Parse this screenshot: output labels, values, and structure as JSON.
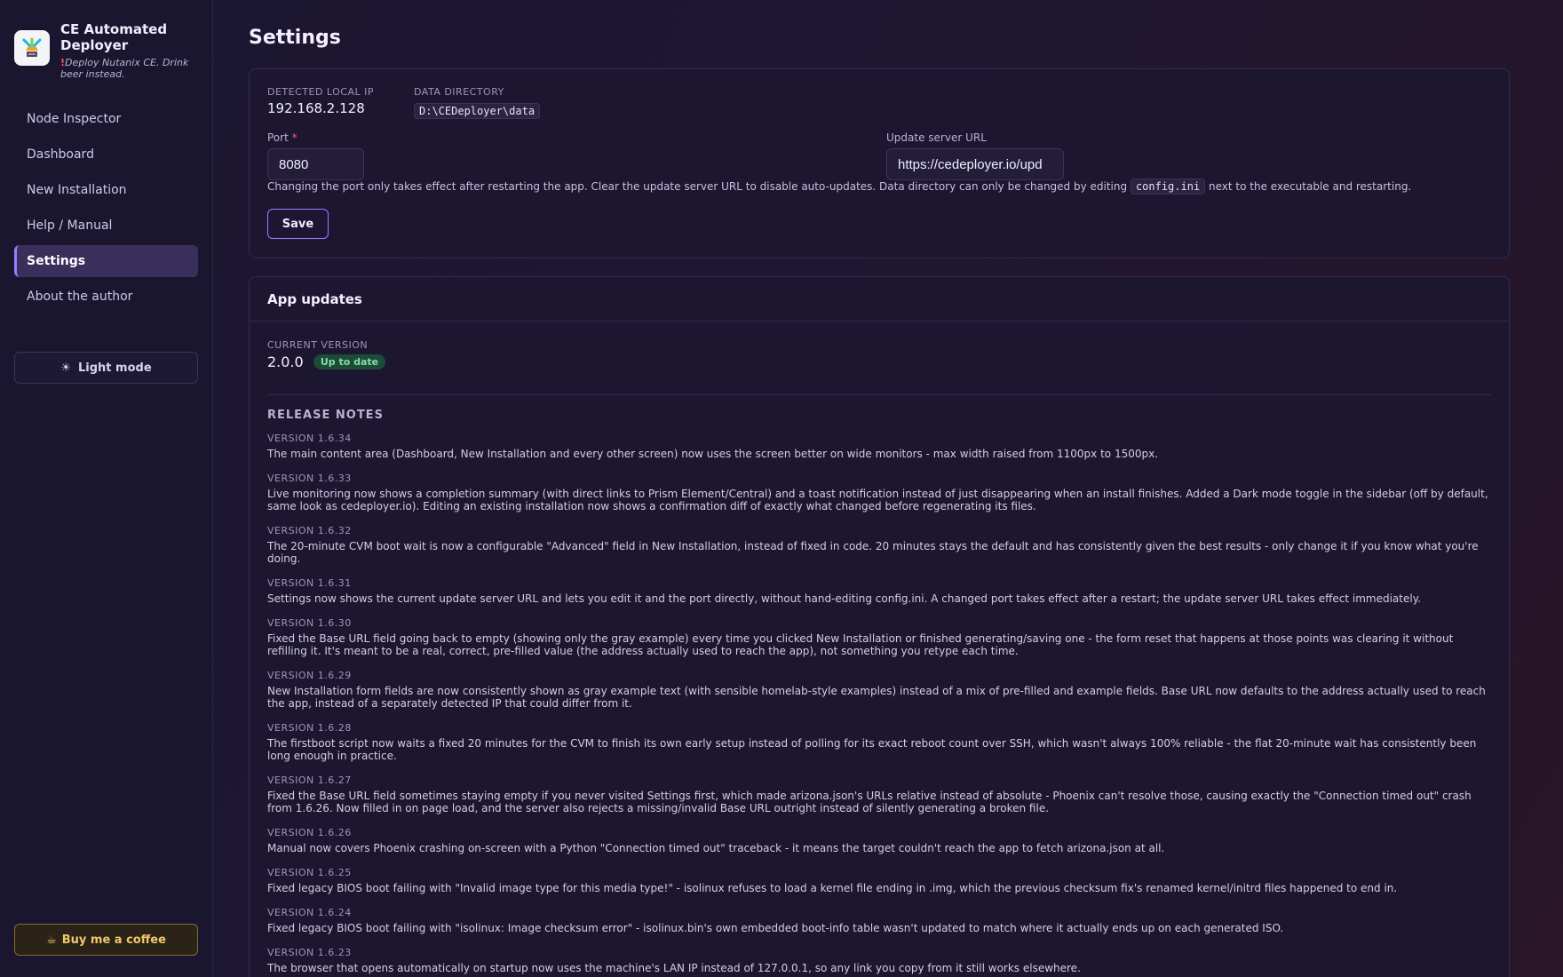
{
  "brand": {
    "title": "CE Automated Deployer",
    "tagline_mark": "!",
    "tagline": "Deploy Nutanix CE. Drink beer instead."
  },
  "sidebar": {
    "items": [
      {
        "label": "Node Inspector",
        "active": false
      },
      {
        "label": "Dashboard",
        "active": false
      },
      {
        "label": "New Installation",
        "active": false
      },
      {
        "label": "Help / Manual",
        "active": false
      },
      {
        "label": "Settings",
        "active": true
      },
      {
        "label": "About the author",
        "active": false
      }
    ],
    "theme_toggle": {
      "icon": "sun-icon",
      "label": "Light mode"
    },
    "coffee": {
      "icon": "coffee-icon",
      "label": "Buy me a coffee"
    }
  },
  "page": {
    "title": "Settings"
  },
  "settings": {
    "local_ip_label": "Detected local IP",
    "local_ip": "192.168.2.128",
    "data_dir_label": "Data directory",
    "data_dir": "D:\\CEDeployer\\data",
    "port_label": "Port",
    "port_required": "*",
    "port_value": "8080",
    "update_url_label": "Update server URL",
    "update_url_value": "https://cedeployer.io/upd",
    "hint_before": "Changing the port only takes effect after restarting the app. Clear the update server URL to disable auto-updates. Data directory can only be changed by editing",
    "hint_code": "config.ini",
    "hint_after": "next to the executable and restarting.",
    "save_label": "Save"
  },
  "updates": {
    "title": "App updates",
    "current_label": "Current version",
    "current_version": "2.0.0",
    "status_badge": "Up to date",
    "release_notes_title": "RELEASE NOTES",
    "notes": [
      {
        "version": "VERSION 1.6.34",
        "text": "The main content area (Dashboard, New Installation and every other screen) now uses the screen better on wide monitors - max width raised from 1100px to 1500px."
      },
      {
        "version": "VERSION 1.6.33",
        "text": "Live monitoring now shows a completion summary (with direct links to Prism Element/Central) and a toast notification instead of just disappearing when an install finishes. Added a Dark mode toggle in the sidebar (off by default, same look as cedeployer.io). Editing an existing installation now shows a confirmation diff of exactly what changed before regenerating its files."
      },
      {
        "version": "VERSION 1.6.32",
        "text": "The 20-minute CVM boot wait is now a configurable \"Advanced\" field in New Installation, instead of fixed in code. 20 minutes stays the default and has consistently given the best results - only change it if you know what you're doing."
      },
      {
        "version": "VERSION 1.6.31",
        "text": "Settings now shows the current update server URL and lets you edit it and the port directly, without hand-editing config.ini. A changed port takes effect after a restart; the update server URL takes effect immediately."
      },
      {
        "version": "VERSION 1.6.30",
        "text": "Fixed the Base URL field going back to empty (showing only the gray example) every time you clicked New Installation or finished generating/saving one - the form reset that happens at those points was clearing it without refilling it. It's meant to be a real, correct, pre-filled value (the address actually used to reach the app), not something you retype each time."
      },
      {
        "version": "VERSION 1.6.29",
        "text": "New Installation form fields are now consistently shown as gray example text (with sensible homelab-style examples) instead of a mix of pre-filled and example fields. Base URL now defaults to the address actually used to reach the app, instead of a separately detected IP that could differ from it."
      },
      {
        "version": "VERSION 1.6.28",
        "text": "The firstboot script now waits a fixed 20 minutes for the CVM to finish its own early setup instead of polling for its exact reboot count over SSH, which wasn't always 100% reliable - the flat 20-minute wait has consistently been long enough in practice."
      },
      {
        "version": "VERSION 1.6.27",
        "text": "Fixed the Base URL field sometimes staying empty if you never visited Settings first, which made arizona.json's URLs relative instead of absolute - Phoenix can't resolve those, causing exactly the \"Connection timed out\" crash from 1.6.26. Now filled in on page load, and the server also rejects a missing/invalid Base URL outright instead of silently generating a broken file."
      },
      {
        "version": "VERSION 1.6.26",
        "text": "Manual now covers Phoenix crashing on-screen with a Python \"Connection timed out\" traceback - it means the target couldn't reach the app to fetch arizona.json at all."
      },
      {
        "version": "VERSION 1.6.25",
        "text": "Fixed legacy BIOS boot failing with \"Invalid image type for this media type!\" - isolinux refuses to load a kernel file ending in .img, which the previous checksum fix's renamed kernel/initrd files happened to end in."
      },
      {
        "version": "VERSION 1.6.24",
        "text": "Fixed legacy BIOS boot failing with \"isolinux: Image checksum error\" - isolinux.bin's own embedded boot-info table wasn't updated to match where it actually ends up on each generated ISO."
      },
      {
        "version": "VERSION 1.6.23",
        "text": "The browser that opens automatically on startup now uses the machine's LAN IP instead of 127.0.0.1, so any link you copy from it still works elsewhere."
      }
    ]
  },
  "colors": {
    "accent": "#9b7bff",
    "success": "#7fe0a7",
    "coffee": "#f0c76a",
    "required": "#ff5a6e"
  }
}
